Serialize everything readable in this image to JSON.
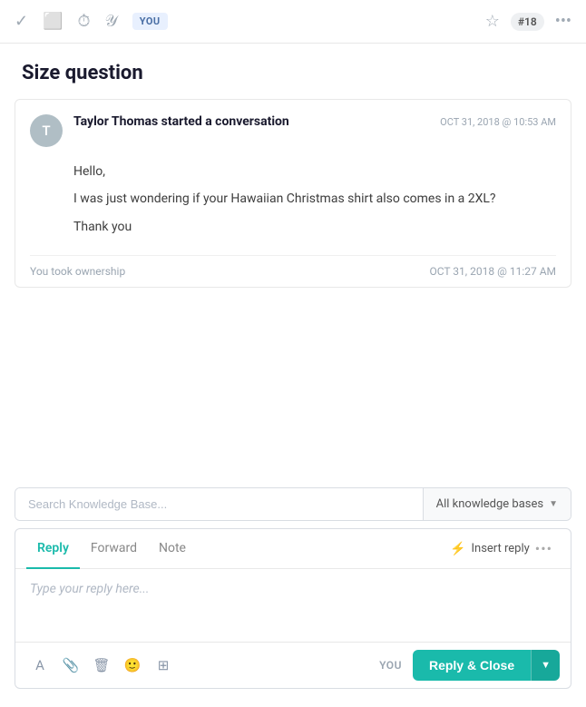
{
  "toolbar": {
    "you_label": "YOU",
    "ticket_number": "#18"
  },
  "page": {
    "title": "Size question"
  },
  "conversation": {
    "author_initial": "T",
    "author_name": "Taylor Thomas",
    "started_label": "started a conversation",
    "timestamp": "OCT 31, 2018 @ 10:53 AM",
    "body_line1": "Hello,",
    "body_line2": "I was just wondering if your Hawaiian Christmas shirt also comes in a 2XL?",
    "body_line3": "Thank you",
    "ownership_text": "You took ownership",
    "ownership_timestamp": "OCT 31, 2018 @ 11:27 AM"
  },
  "knowledge_base": {
    "search_placeholder": "Search Knowledge Base...",
    "dropdown_label": "All knowledge bases"
  },
  "reply_area": {
    "tab_reply": "Reply",
    "tab_forward": "Forward",
    "tab_note": "Note",
    "insert_reply_label": "Insert reply",
    "editor_placeholder": "Type your reply here...",
    "you_label": "YOU",
    "reply_close_label": "Reply & Close"
  }
}
